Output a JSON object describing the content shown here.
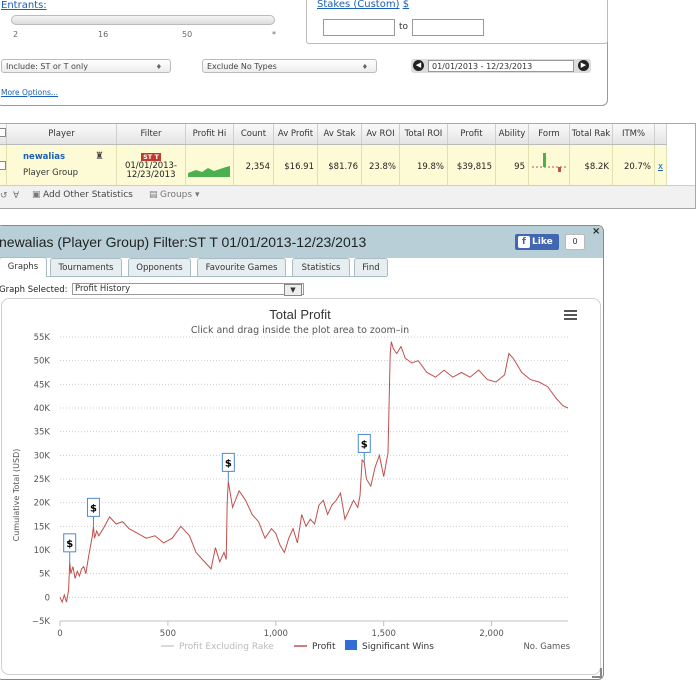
{
  "filters": {
    "entrants_label": "Entrants:",
    "entrants_ticks": [
      "2",
      "16",
      "50",
      "*"
    ],
    "stakes_label": "Stakes (Custom)",
    "stakes_currency": "$",
    "stakes_to": "to",
    "stakes_from_value": "",
    "stakes_to_value": "",
    "include_select": "Include: ST or T only",
    "exclude_select": "Exclude No Types",
    "date_range": "01/01/2013 - 12/23/2013",
    "more_options": "More Options..."
  },
  "stats_table": {
    "columns": [
      "Player",
      "Filter",
      "Profit Hi",
      "Count",
      "Av Profit",
      "Av Stak",
      "Av ROI",
      "Total ROI",
      "Profit",
      "Ability",
      "Form",
      "Total Rak",
      "ITM%"
    ],
    "row": {
      "player_name": "newalias",
      "player_group": "Player Group",
      "filter_badge": "ST T",
      "filter_from": "01/01/2013-",
      "filter_to": "12/23/2013",
      "count": "2,354",
      "av_profit": "$16.91",
      "av_stake": "$81.76",
      "av_roi": "23.8%",
      "total_roi": "19.8%",
      "profit": "$39,815",
      "ability": "95",
      "total_rake": "$8.2K",
      "itm": "20.7%",
      "remove": "x"
    },
    "toolbar": {
      "add_stats": "Add Other Statistics",
      "groups": "Groups"
    }
  },
  "graph_window": {
    "title": "newalias (Player Group) Filter:ST T 01/01/2013-12/23/2013",
    "like_label": "Like",
    "like_count": "0",
    "tabs": [
      "Graphs",
      "Tournaments",
      "Opponents",
      "Favourite Games",
      "Statistics",
      "Find"
    ],
    "active_tab": "Graphs",
    "graph_selected_label": "Graph Selected:",
    "graph_selected_value": "Profit History"
  },
  "chart_data": {
    "type": "line",
    "title": "Total Profit",
    "subtitle": "Click and drag inside the plot area to zoom–in",
    "ylabel": "Cumulative Total (USD)",
    "xlabel": "No. Games",
    "ylim": [
      -5000,
      55000
    ],
    "xlim": [
      0,
      2354
    ],
    "y_ticks": [
      "−5K",
      "0",
      "5K",
      "10K",
      "15K",
      "20K",
      "25K",
      "30K",
      "35K",
      "40K",
      "45K",
      "50K",
      "55K"
    ],
    "x_ticks": [
      "0",
      "500",
      "1,000",
      "1,500",
      "2,000"
    ],
    "x_tick_values": [
      0,
      500,
      1000,
      1500,
      2000
    ],
    "y_tick_values": [
      -5000,
      0,
      5000,
      10000,
      15000,
      20000,
      25000,
      30000,
      35000,
      40000,
      45000,
      50000,
      55000
    ],
    "legend": [
      "Profit Excluding Rake",
      "Profit",
      "Significant Wins"
    ],
    "colors": {
      "profit": "#c0504d",
      "excl_rake": "#cccccc",
      "significant": "#2f6fd6",
      "grid": "#cccccc"
    },
    "series": [
      {
        "name": "Profit",
        "x": [
          0,
          10,
          20,
          30,
          40,
          45,
          50,
          60,
          70,
          80,
          90,
          100,
          110,
          120,
          130,
          140,
          150,
          155,
          160,
          170,
          180,
          200,
          230,
          260,
          290,
          320,
          360,
          400,
          440,
          480,
          520,
          560,
          600,
          630,
          660,
          700,
          720,
          740,
          760,
          770,
          775,
          780,
          800,
          830,
          860,
          890,
          920,
          950,
          980,
          1000,
          1020,
          1040,
          1060,
          1080,
          1100,
          1120,
          1140,
          1160,
          1180,
          1200,
          1220,
          1240,
          1260,
          1280,
          1300,
          1320,
          1340,
          1360,
          1380,
          1390,
          1400,
          1410,
          1420,
          1440,
          1460,
          1480,
          1500,
          1520,
          1530,
          1535,
          1545,
          1560,
          1580,
          1600,
          1630,
          1660,
          1700,
          1740,
          1780,
          1820,
          1860,
          1900,
          1940,
          1980,
          2020,
          2060,
          2080,
          2100,
          2140,
          2180,
          2220,
          2260,
          2300,
          2330,
          2354
        ],
        "values": [
          0,
          -1000,
          500,
          -1000,
          1500,
          7500,
          5000,
          6500,
          4000,
          5500,
          4500,
          6000,
          6500,
          5000,
          8000,
          10500,
          13000,
          15000,
          12500,
          14000,
          13000,
          14500,
          17000,
          15500,
          16000,
          14500,
          13500,
          12500,
          13000,
          11500,
          12500,
          15000,
          13000,
          9500,
          8000,
          6000,
          10500,
          7500,
          9500,
          8000,
          20000,
          24500,
          19000,
          22500,
          20500,
          17500,
          16000,
          12500,
          14500,
          13500,
          11000,
          9500,
          12500,
          14500,
          11500,
          17500,
          15000,
          16500,
          15500,
          19500,
          20500,
          17500,
          19500,
          20500,
          22000,
          16500,
          18500,
          20500,
          19000,
          21500,
          29000,
          28500,
          25000,
          23500,
          27500,
          30000,
          25500,
          30500,
          51500,
          54000,
          52500,
          51500,
          53000,
          50500,
          49500,
          50000,
          47500,
          46500,
          48000,
          46500,
          47500,
          46500,
          48000,
          46000,
          45500,
          47000,
          51500,
          50500,
          47500,
          46000,
          45500,
          44500,
          42000,
          40500,
          40000
        ]
      }
    ],
    "significant_wins": [
      {
        "x": 45,
        "y": 7500,
        "label": "$"
      },
      {
        "x": 155,
        "y": 15000,
        "label": "$"
      },
      {
        "x": 780,
        "y": 24500,
        "label": "$"
      },
      {
        "x": 1410,
        "y": 28500,
        "label": "$"
      }
    ]
  }
}
